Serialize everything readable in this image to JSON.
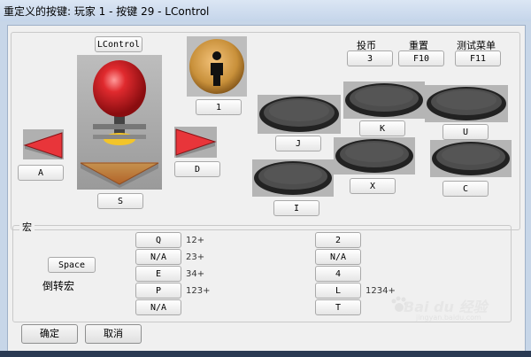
{
  "window": {
    "title": "重定义的按键: 玩家 1 - 按键 29 - LControl"
  },
  "top_labels": {
    "coin": "投币",
    "reset": "重置",
    "test_menu": "测试菜单"
  },
  "top_values": {
    "coin": "3",
    "reset": "F10",
    "test_menu": "F11"
  },
  "joystick": {
    "up_key": "LControl",
    "down_key": "S",
    "left_key": "A",
    "right_key": "D"
  },
  "player_button": {
    "key": "1"
  },
  "action_keys": {
    "j": "J",
    "k": "K",
    "u": "U",
    "i": "I",
    "x": "X",
    "c": "C"
  },
  "macro": {
    "group_title": "宏",
    "space_button": "Space",
    "reverse_label": "倒转宏",
    "left_column": [
      {
        "key": "Q",
        "combo": "12+"
      },
      {
        "key": "N/A",
        "combo": "23+"
      },
      {
        "key": "E",
        "combo": "34+"
      },
      {
        "key": "P",
        "combo": "123+"
      },
      {
        "key": "N/A",
        "combo": ""
      }
    ],
    "right_column": [
      {
        "key": "2",
        "combo": ""
      },
      {
        "key": "N/A",
        "combo": ""
      },
      {
        "key": "4",
        "combo": ""
      },
      {
        "key": "L",
        "combo": "1234+"
      },
      {
        "key": "T",
        "combo": ""
      }
    ]
  },
  "footer": {
    "ok": "确定",
    "cancel": "取消"
  },
  "watermark": {
    "main": "Bai du 经验",
    "sub": "jingyan.baidu.com"
  },
  "colors": {
    "ball_red": "#d8262c",
    "arrow_red": "#e8353a",
    "arrow_orange": "#f28a1c",
    "coin_bronze": "#c8903a"
  }
}
